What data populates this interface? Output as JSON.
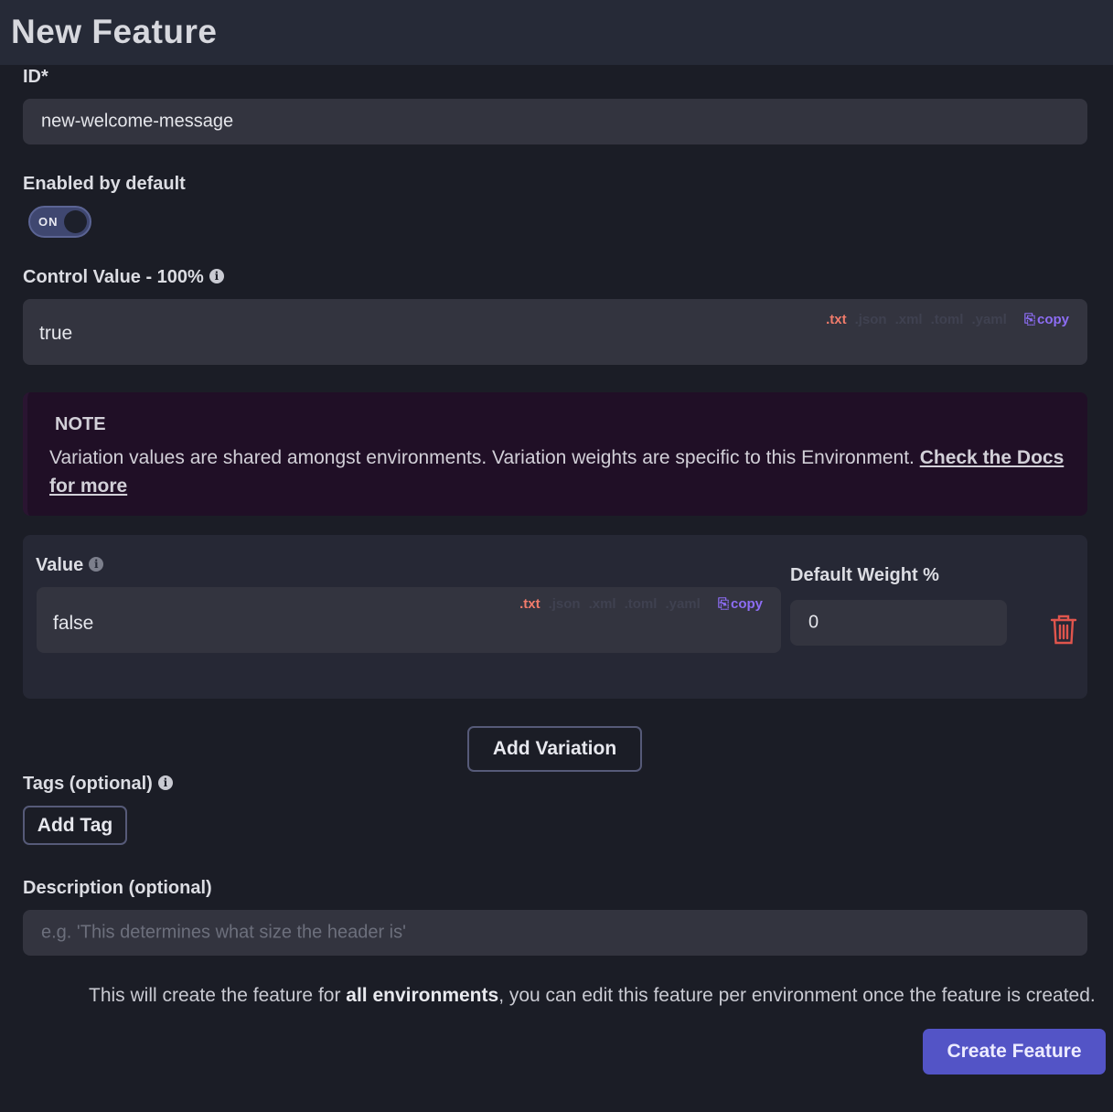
{
  "header": {
    "title": "New Feature"
  },
  "id_field": {
    "label": "ID*",
    "value": "new-welcome-message"
  },
  "enabled": {
    "label": "Enabled by default",
    "toggle_label": "ON"
  },
  "control_value": {
    "label": "Control Value - 100%",
    "value": "true",
    "formats": [
      ".txt",
      ".json",
      ".xml",
      ".toml",
      ".yaml"
    ],
    "active_format": ".txt",
    "copy_label": "copy"
  },
  "note": {
    "title": "NOTE",
    "text": "Variation values are shared amongst environments. Variation weights are specific to this Environment. ",
    "link": "Check the Docs for more"
  },
  "variation": {
    "value_label": "Value",
    "value": "false",
    "formats": [
      ".txt",
      ".json",
      ".xml",
      ".toml",
      ".yaml"
    ],
    "copy_label": "copy",
    "weight_label": "Default Weight %",
    "weight_value": "0"
  },
  "add_variation_label": "Add Variation",
  "tags": {
    "label": "Tags (optional)",
    "add_label": "Add Tag"
  },
  "description": {
    "label": "Description (optional)",
    "placeholder": "e.g. 'This determines what size the header is'"
  },
  "footer": {
    "text_before": "This will create the feature for ",
    "text_bold": "all environments",
    "text_after": ", you can edit this feature per environment once the feature is created."
  },
  "create_label": "Create Feature",
  "colors": {
    "accent": "#5354c6",
    "active_format": "#f07b6b",
    "copy": "#8d6df4",
    "danger": "#e0554d"
  }
}
